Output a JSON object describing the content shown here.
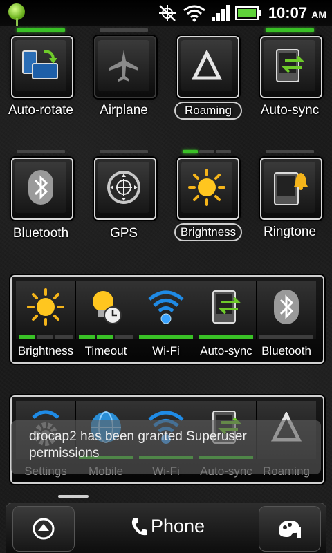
{
  "status": {
    "time": "10:07",
    "ampm": "AM"
  },
  "toggles_row1": [
    {
      "label": "Auto-rotate",
      "state": "on"
    },
    {
      "label": "Airplane",
      "state": "off"
    },
    {
      "label": "Roaming",
      "state": "off"
    },
    {
      "label": "Auto-sync",
      "state": "on"
    }
  ],
  "toggles_row2": [
    {
      "label": "Bluetooth",
      "state": "off"
    },
    {
      "label": "GPS",
      "state": "off"
    },
    {
      "label": "Brightness",
      "state": "partial"
    },
    {
      "label": "Ringtone",
      "state": "off"
    }
  ],
  "strip1": [
    {
      "label": "Brightness",
      "state": "partial"
    },
    {
      "label": "Timeout",
      "state": "partial"
    },
    {
      "label": "Wi-Fi",
      "state": "on"
    },
    {
      "label": "Auto-sync",
      "state": "on"
    },
    {
      "label": "Bluetooth",
      "state": "off"
    }
  ],
  "strip2": [
    {
      "label": "Settings"
    },
    {
      "label": "Mobile"
    },
    {
      "label": "Wi-Fi"
    },
    {
      "label": "Auto-sync"
    },
    {
      "label": "Roaming"
    }
  ],
  "toast": {
    "text": "drocap2 has been granted Superuser permissions"
  },
  "dock": {
    "phone_label": "Phone"
  },
  "colors": {
    "accent_green": "#39c126",
    "background": "#1b1b1b"
  }
}
